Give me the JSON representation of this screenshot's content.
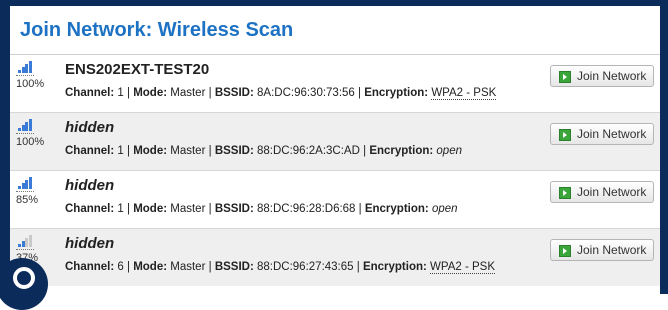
{
  "page": {
    "title": "Join Network: Wireless Scan"
  },
  "networks": [
    {
      "ssid": "ENS202EXT-TEST20",
      "signal_percent": 100,
      "signal_label": "100%",
      "channel": "1",
      "mode": "Master",
      "bssid": "8A:DC:96:30:73:56",
      "encryption": "WPA2 - PSK",
      "hidden": false,
      "button": "Join Network"
    },
    {
      "ssid": "hidden",
      "signal_percent": 100,
      "signal_label": "100%",
      "channel": "1",
      "mode": "Master",
      "bssid": "88:DC:96:2A:3C:AD",
      "encryption": "open",
      "hidden": true,
      "button": "Join Network"
    },
    {
      "ssid": "hidden",
      "signal_percent": 85,
      "signal_label": "85%",
      "channel": "1",
      "mode": "Master",
      "bssid": "88:DC:96:28:D6:68",
      "encryption": "open",
      "hidden": true,
      "button": "Join Network"
    },
    {
      "ssid": "hidden",
      "signal_percent": 37,
      "signal_label": "37%",
      "channel": "6",
      "mode": "Master",
      "bssid": "88:DC:96:27:43:65",
      "encryption": "WPA2 - PSK",
      "hidden": true,
      "button": "Join Network"
    }
  ],
  "labels": {
    "channel": "Channel:",
    "mode": "Mode:",
    "bssid": "BSSID:",
    "encryption": "Encryption:"
  },
  "colors": {
    "title": "#1e72c4",
    "frame": "#0b2b5b",
    "signal_bar": "#3a7bd5",
    "join_icon": "#3aa63a"
  }
}
